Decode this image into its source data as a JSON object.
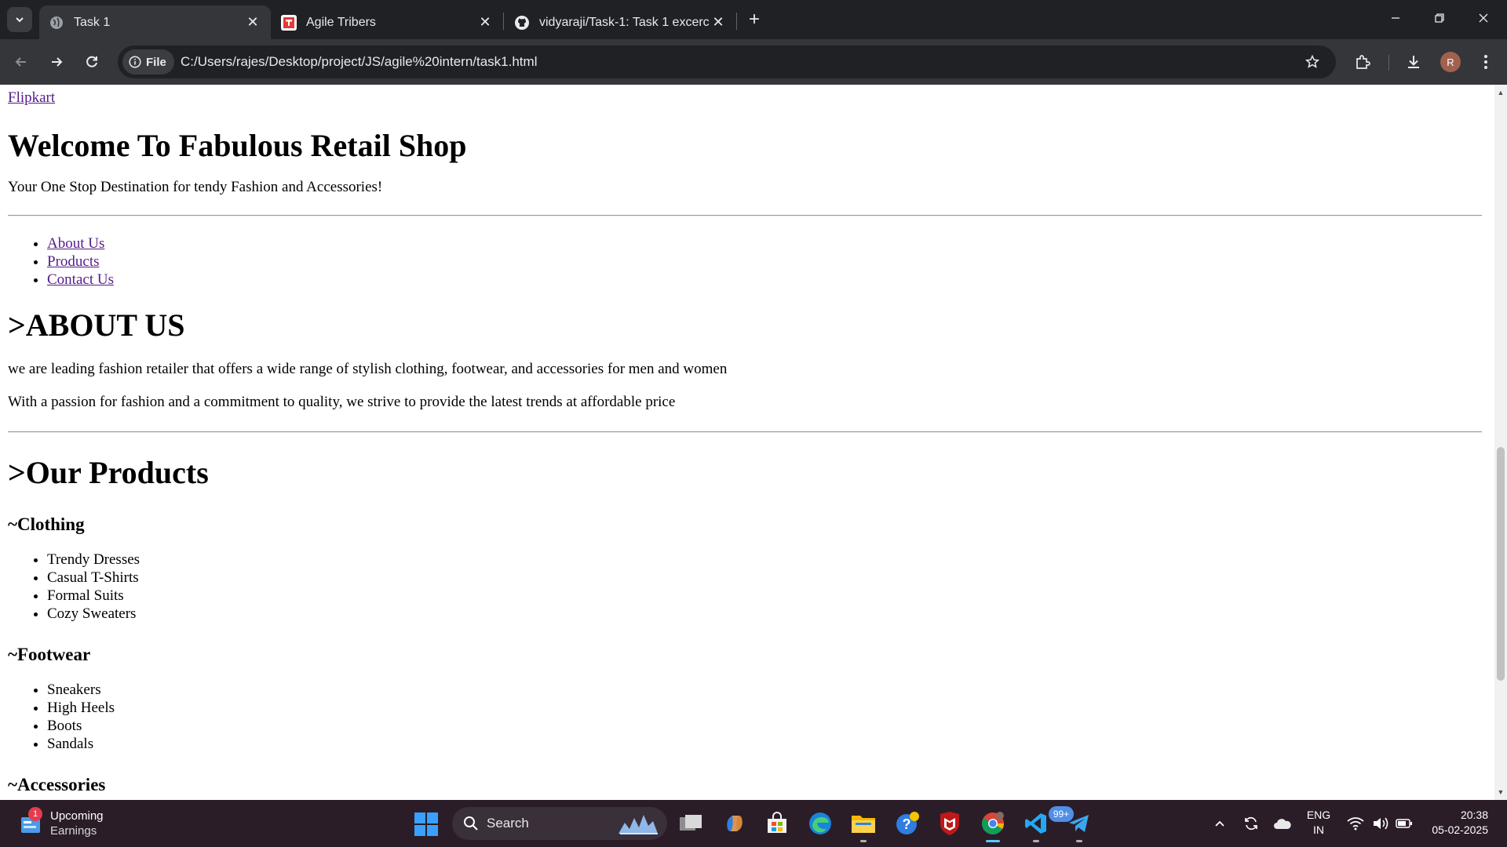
{
  "browser": {
    "tabs": [
      {
        "title": "Task 1",
        "active": true
      },
      {
        "title": "Agile Tribers",
        "active": false
      },
      {
        "title": "vidyaraji/Task-1: Task 1 excercise",
        "active": false
      }
    ],
    "address": {
      "chip_label": "File",
      "url": "C:/Users/rajes/Desktop/project/JS/agile%20intern/task1.html"
    },
    "profile_initial": "R"
  },
  "page": {
    "brand_link": "Flipkart",
    "title": "Welcome To Fabulous Retail Shop",
    "tagline": "Your One Stop Destination for tendy Fashion and Accessories!",
    "nav": [
      "About Us",
      "Products",
      "Contact Us"
    ],
    "about": {
      "heading": ">ABOUT US",
      "para1": "we are leading fashion retailer that offers a wide range of stylish clothing, footwear, and accessories for men and women",
      "para2": "With a passion for fashion and a commitment to quality, we strive to provide the latest trends at affordable price"
    },
    "products": {
      "heading": ">Our Products",
      "categories": [
        {
          "name": "~Clothing",
          "items": [
            "Trendy Dresses",
            "Casual T-Shirts",
            "Formal Suits",
            "Cozy Sweaters"
          ]
        },
        {
          "name": "~Footwear",
          "items": [
            "Sneakers",
            "High Heels",
            "Boots",
            "Sandals"
          ]
        },
        {
          "name": "~Accessories",
          "items": []
        }
      ]
    }
  },
  "taskbar": {
    "widget": {
      "badge": "1",
      "title": "Upcoming",
      "subtitle": "Earnings"
    },
    "search_label": "Search",
    "notification_badge": "99+",
    "lang_line1": "ENG",
    "lang_line2": "IN",
    "time": "20:38",
    "date": "05-02-2025"
  }
}
